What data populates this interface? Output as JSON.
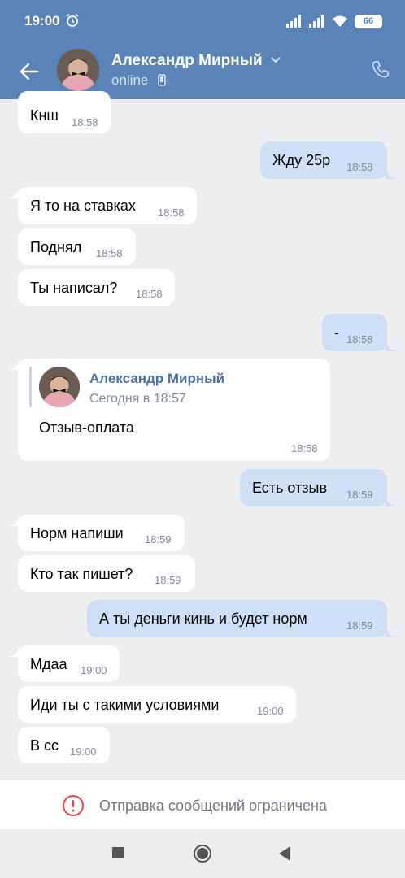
{
  "status_bar": {
    "time": "19:00",
    "battery": "66"
  },
  "header": {
    "contact_name": "Александр Мирный",
    "status": "online"
  },
  "messages": [
    {
      "dir": "in",
      "text": "Кнш",
      "time": "18:58"
    },
    {
      "dir": "out",
      "text": "Жду 25р",
      "time": "18:58"
    },
    {
      "dir": "in",
      "text": "Я то на ставках",
      "time": "18:58"
    },
    {
      "dir": "in",
      "text": "Поднял",
      "time": "18:58"
    },
    {
      "dir": "in",
      "text": "Ты написал?",
      "time": "18:58"
    },
    {
      "dir": "out",
      "text": "-",
      "time": "18:58"
    },
    {
      "dir": "in",
      "text": "Отзыв-оплата",
      "time": "18:58",
      "forwarded": {
        "author": "Александр Мирный",
        "date": "Сегодня в 18:57"
      }
    },
    {
      "dir": "out",
      "text": "Есть отзыв",
      "time": "18:59"
    },
    {
      "dir": "in",
      "text": "Норм напиши",
      "time": "18:59"
    },
    {
      "dir": "in",
      "text": "Кто так пишет?",
      "time": "18:59"
    },
    {
      "dir": "out",
      "text": "А ты деньги кинь и будет норм",
      "time": "18:59"
    },
    {
      "dir": "in",
      "text": "Мдаа",
      "time": "19:00"
    },
    {
      "dir": "in",
      "text": "Иди ты с такими условиями",
      "time": "19:00"
    },
    {
      "dir": "in",
      "text": "В сс",
      "time": "19:00"
    }
  ],
  "restriction": {
    "text": "Отправка сообщений ограничена"
  },
  "colors": {
    "header": "#5a84b8",
    "incoming": "#ffffff",
    "outgoing": "#cfe0f6",
    "background": "#edeef0",
    "warning": "#e64646"
  }
}
